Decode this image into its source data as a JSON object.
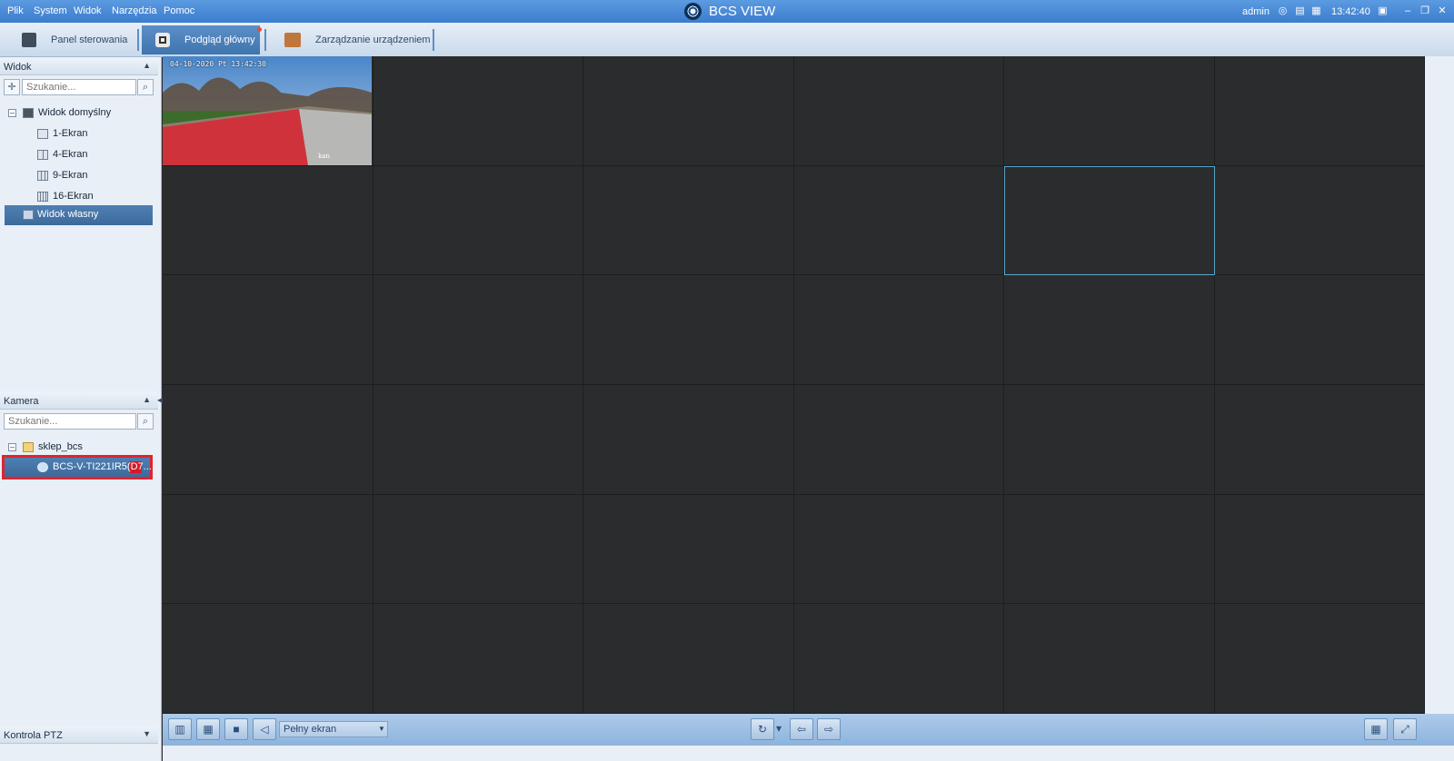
{
  "menu": {
    "items": [
      "Plik",
      "System",
      "Widok",
      "Narzędzia",
      "Pomoc"
    ]
  },
  "app": {
    "title": "BCS VIEW",
    "user": "admin",
    "clock": "13:42:40",
    "status_icons": [
      "globe-icon",
      "monitor-icon",
      "network-icon",
      "lock-icon"
    ],
    "window_buttons": [
      "minimize",
      "restore",
      "close"
    ]
  },
  "tabs": [
    {
      "label": "Panel sterowania",
      "icon": "home-icon",
      "active": false
    },
    {
      "label": "Podgląd główny",
      "icon": "camera-icon",
      "active": true
    },
    {
      "label": "Zarządzanie urządzeniem",
      "icon": "device-icon",
      "active": false
    }
  ],
  "view_panel": {
    "title": "Widok",
    "search_placeholder": "Szukanie...",
    "tree": [
      {
        "label": "Widok domyślny",
        "expanded": true
      },
      {
        "label": "1-Ekran"
      },
      {
        "label": "4-Ekran"
      },
      {
        "label": "9-Ekran"
      },
      {
        "label": "16-Ekran"
      },
      {
        "label": "Widok własny",
        "selected": true
      }
    ]
  },
  "camera_panel": {
    "title": "Kamera",
    "search_placeholder": "Szukanie...",
    "group": "sklep_bcs",
    "camera": "BCS-V-TI221IR5(D7..."
  },
  "ptz_panel": {
    "title": "Kontrola PTZ"
  },
  "video": {
    "osd_time": "04-10-2020 Pt 13:42:30",
    "osd_name": "kan"
  },
  "toolbar": {
    "fullscreen_label": "Pełny ekran"
  },
  "colors": {
    "accent": "#3b7ccf",
    "grid_bg": "#2b2c2e",
    "active_cell": "#5aa5c9",
    "highlight": "#e0242f"
  }
}
